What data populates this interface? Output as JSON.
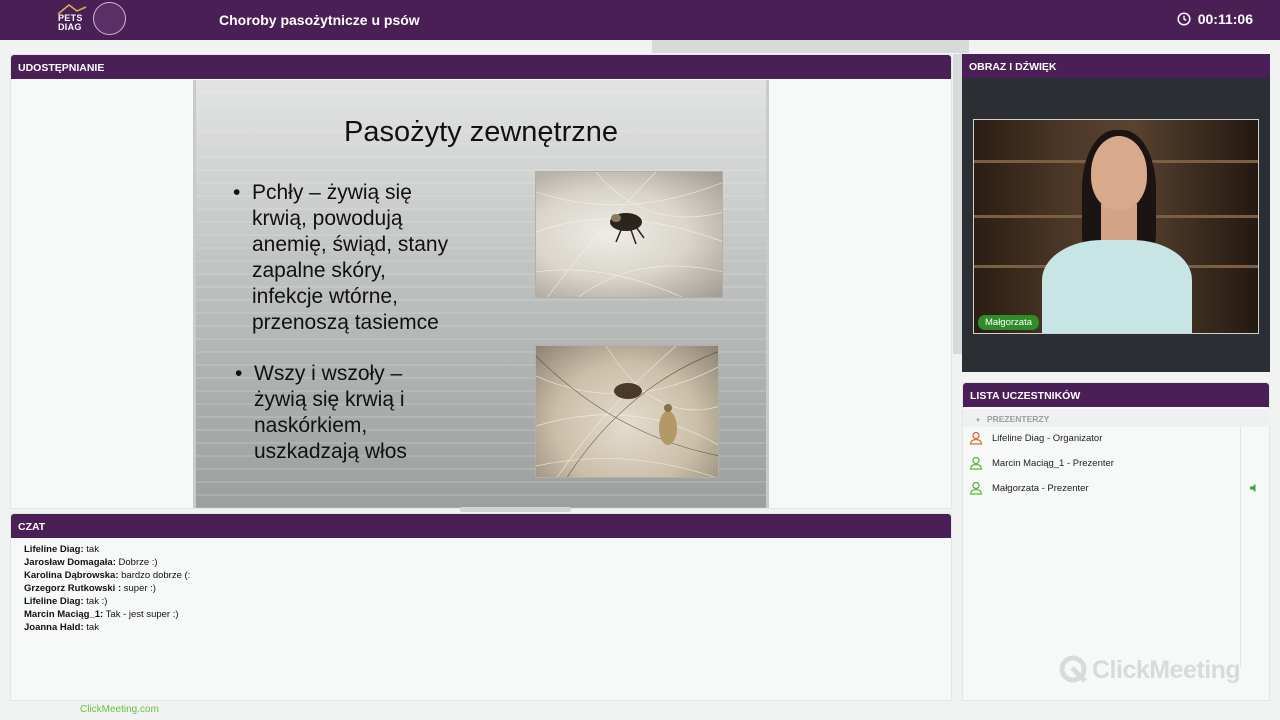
{
  "topbar": {
    "logo_line1": "PETS",
    "logo_line2": "DIAG",
    "title": "Choroby pasożytnicze u psów",
    "timer": "00:11:06"
  },
  "share_panel": {
    "title": "UDOSTĘPNIANIE",
    "slide": {
      "title": "Pasożyty zewnętrzne",
      "bullet1_lines": [
        "Pchły – żywią się",
        "krwią, powodują",
        "anemię, świąd, stany",
        "zapalne skóry,",
        "infekcje wtórne,",
        "przenoszą tasiemce"
      ],
      "bullet2_lines": [
        "Wszy i wszoły –",
        "żywią się krwią i",
        "naskórkiem,",
        "uszkadzają włos"
      ],
      "bullet_char": "•"
    }
  },
  "chat": {
    "title": "CZAT",
    "messages": [
      {
        "author": "Lifeline Diag:",
        "text": "tak"
      },
      {
        "author": "Jarosław Domagała:",
        "text": "Dobrze :)"
      },
      {
        "author": "Karolina Dąbrowska:",
        "text": "bardzo dobrze (:"
      },
      {
        "author": "Grzegorz  Rutkowski :",
        "text": "super :)"
      },
      {
        "author": "Lifeline Diag:",
        "text": "tak :)"
      },
      {
        "author": "Marcin Maciąg_1:",
        "text": "Tak - jest super :)"
      },
      {
        "author": "Joanna Hald:",
        "text": "tak"
      }
    ]
  },
  "video": {
    "title": "OBRAZ I DŹWIĘK",
    "name_badge": "Małgorzata"
  },
  "participants": {
    "title": "LISTA UCZESTNIKÓW",
    "group": "PREZENTERZY",
    "rows": [
      {
        "label": "Lifeline Diag  - Organizator",
        "icon_color": "#e06a35"
      },
      {
        "label": "Marcin Maciąg_1 - Prezenter",
        "icon_color": "#5cb83a"
      },
      {
        "label": "Małgorzata  - Prezenter",
        "icon_color": "#5cb83a"
      }
    ]
  },
  "branding": {
    "clickmeeting_logo": "ClickMeeting",
    "footer_link": "ClickMeeting.com"
  }
}
